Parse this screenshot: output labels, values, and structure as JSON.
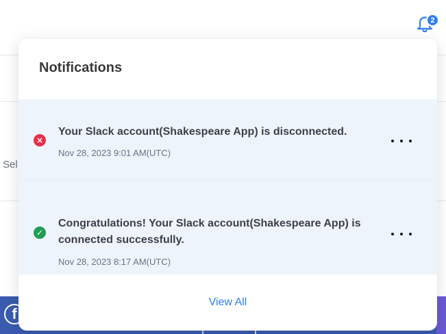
{
  "background": {
    "cut_text": "Sel",
    "social_icon": "facebook-icon",
    "social_glyph": "f"
  },
  "header": {
    "bell_icon": "bell-icon",
    "badge_count": "2"
  },
  "notifications": {
    "title": "Notifications",
    "items": [
      {
        "status": "error",
        "status_icon": "error-x-icon",
        "status_glyph": "×",
        "message": "Your Slack account(Shakespeare App) is disconnected.",
        "time": "Nov 28, 2023 9:01 AM(UTC)"
      },
      {
        "status": "success",
        "status_icon": "success-check-icon",
        "status_glyph": "✓",
        "message": "Congratulations! Your Slack account(Shakespeare App) is connected successfully.",
        "time": "Nov 28, 2023 8:17 AM(UTC)"
      }
    ],
    "view_all_label": "View All"
  },
  "colors": {
    "accent": "#2f80ed",
    "error": "#e5304d",
    "success": "#1f9d55",
    "item_background": "#eef4fc"
  }
}
